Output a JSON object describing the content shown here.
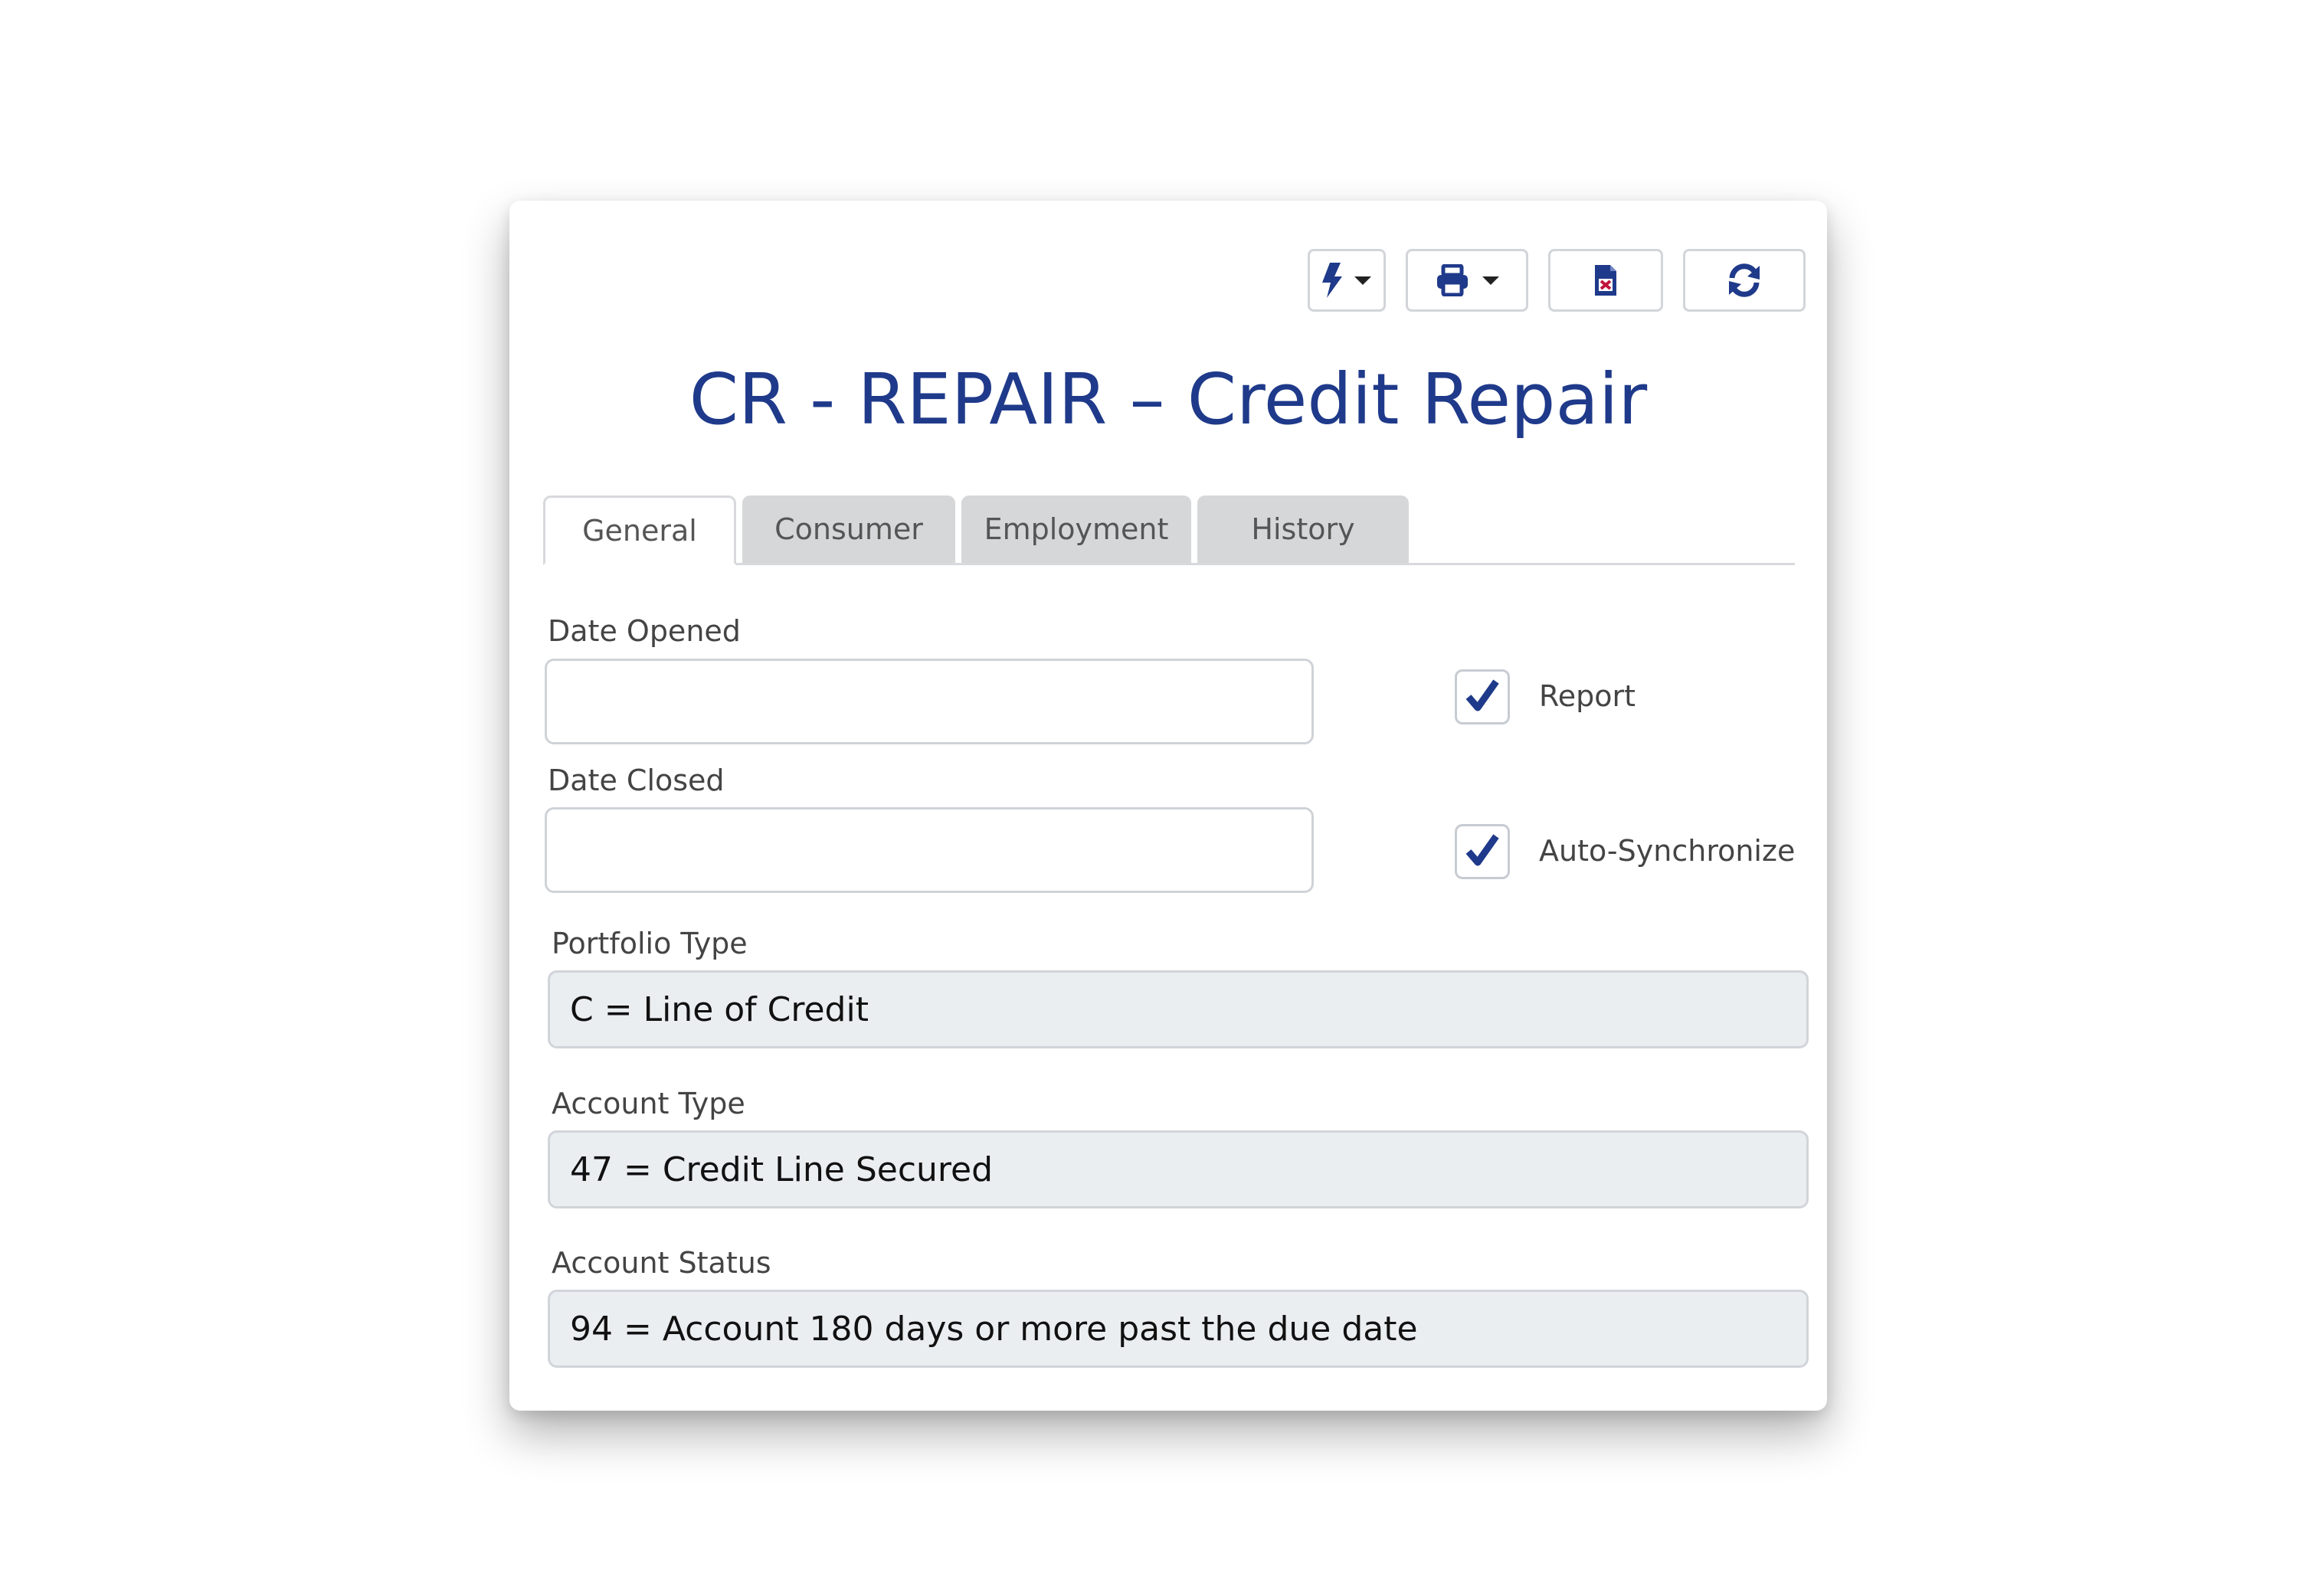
{
  "toolbar": {
    "actions_icon": "lightning-bolt-icon",
    "print_icon": "printer-icon",
    "export_icon": "excel-file-icon",
    "refresh_icon": "refresh-icon"
  },
  "title": "CR - REPAIR – Credit Repair",
  "tabs": [
    {
      "label": "General",
      "active": true
    },
    {
      "label": "Consumer",
      "active": false
    },
    {
      "label": "Employment",
      "active": false
    },
    {
      "label": "History",
      "active": false
    }
  ],
  "form": {
    "date_opened": {
      "label": "Date Opened",
      "value": ""
    },
    "date_closed": {
      "label": "Date Closed",
      "value": ""
    },
    "report": {
      "label": "Report",
      "checked": true
    },
    "auto_sync": {
      "label": "Auto-Synchronize",
      "checked": true
    },
    "portfolio_type": {
      "label": "Portfolio Type",
      "value": "C = Line of Credit"
    },
    "account_type": {
      "label": "Account Type",
      "value": "47 = Credit Line Secured"
    },
    "account_status": {
      "label": "Account Status",
      "value": "94 = Account 180 days or more past the due date"
    }
  },
  "colors": {
    "accent": "#1f3a8a",
    "tab_inactive": "#d6d7d8",
    "readonly_field": "#eaeef1"
  }
}
